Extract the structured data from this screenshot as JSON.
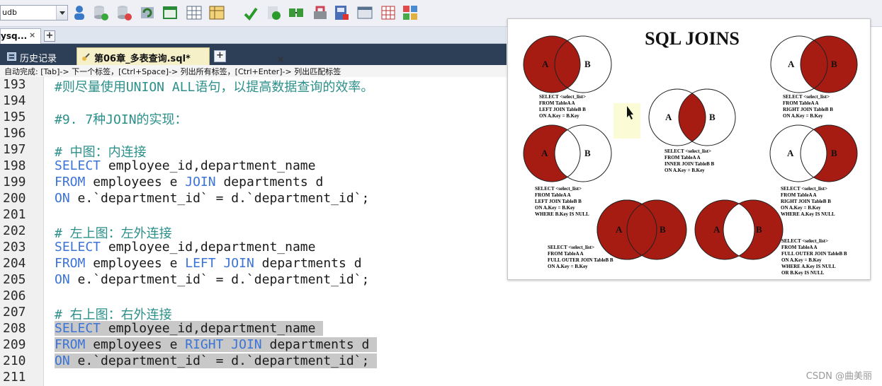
{
  "toolbar": {
    "db_select_value": "udb"
  },
  "tabs_top": {
    "connection_tab": "ysq...",
    "close_glyph": "×",
    "add_glyph": "+"
  },
  "editor_tabs": {
    "history": "历史记录",
    "sql_file": "第06章_多表查询.sql*",
    "close_glyph": "×",
    "add_glyph": "+"
  },
  "hint": "自动完成: [Tab]-> 下一个标签，[Ctrl+Space]-> 列出所有标签，[Ctrl+Enter]-> 列出匹配标签",
  "lines": [
    {
      "n": "193",
      "parts": [
        {
          "t": "#则尽量使用UNION ALL语句，以提高数据查询的效率。",
          "c": "cm"
        }
      ]
    },
    {
      "n": "194",
      "parts": []
    },
    {
      "n": "195",
      "parts": [
        {
          "t": "#9. 7种JOIN的实现：",
          "c": "cm"
        }
      ]
    },
    {
      "n": "196",
      "parts": []
    },
    {
      "n": "197",
      "parts": [
        {
          "t": "# 中图：内连接",
          "c": "cm"
        }
      ]
    },
    {
      "n": "198",
      "parts": [
        {
          "t": "SELECT",
          "c": "kw"
        },
        {
          "t": " employee_id,department_name",
          "c": ""
        }
      ]
    },
    {
      "n": "199",
      "parts": [
        {
          "t": "FROM",
          "c": "kw"
        },
        {
          "t": " employees e ",
          "c": ""
        },
        {
          "t": "JOIN",
          "c": "kw"
        },
        {
          "t": " departments d",
          "c": ""
        }
      ]
    },
    {
      "n": "200",
      "parts": [
        {
          "t": "ON",
          "c": "kw"
        },
        {
          "t": " e.`department_id` = d.`department_id`;",
          "c": ""
        }
      ]
    },
    {
      "n": "201",
      "parts": []
    },
    {
      "n": "202",
      "parts": [
        {
          "t": "# 左上图：左外连接",
          "c": "cm"
        }
      ]
    },
    {
      "n": "203",
      "parts": [
        {
          "t": "SELECT",
          "c": "kw"
        },
        {
          "t": " employee_id,department_name",
          "c": ""
        }
      ]
    },
    {
      "n": "204",
      "parts": [
        {
          "t": "FROM",
          "c": "kw"
        },
        {
          "t": " employees e ",
          "c": ""
        },
        {
          "t": "LEFT",
          "c": "kw"
        },
        {
          "t": " ",
          "c": ""
        },
        {
          "t": "JOIN",
          "c": "kw"
        },
        {
          "t": " departments d",
          "c": ""
        }
      ]
    },
    {
      "n": "205",
      "parts": [
        {
          "t": "ON",
          "c": "kw"
        },
        {
          "t": " e.`department_id` = d.`department_id`;",
          "c": ""
        }
      ]
    },
    {
      "n": "206",
      "parts": []
    },
    {
      "n": "207",
      "parts": [
        {
          "t": "# 右上图：右外连接",
          "c": "cm"
        }
      ]
    },
    {
      "n": "208",
      "parts": [
        {
          "t": "SELECT",
          "c": "kw"
        },
        {
          "t": " employee_id,department_name",
          "c": ""
        }
      ],
      "selected": true
    },
    {
      "n": "209",
      "parts": [
        {
          "t": "FROM",
          "c": "kw"
        },
        {
          "t": " employees e ",
          "c": ""
        },
        {
          "t": "RIGHT",
          "c": "kw"
        },
        {
          "t": " ",
          "c": ""
        },
        {
          "t": "JOIN",
          "c": "kw"
        },
        {
          "t": " departments d",
          "c": ""
        }
      ],
      "selected": true
    },
    {
      "n": "210",
      "parts": [
        {
          "t": "ON",
          "c": "kw"
        },
        {
          "t": " e.`department_id` = d.`department_id`;",
          "c": ""
        }
      ],
      "selected": true
    },
    {
      "n": "211",
      "parts": []
    }
  ],
  "joins": {
    "title": "SQL JOINS",
    "label_a": "A",
    "label_b": "B",
    "fill_color": "#a61b12",
    "captions": {
      "left_top": [
        "SELECT <select_list>",
        "FROM TableA A",
        "LEFT JOIN TableB B",
        "ON A.Key = B.Key"
      ],
      "right_top": [
        "SELECT <select_list>",
        "FROM TableA A",
        "RIGHT JOIN TableB B",
        "ON A.Key = B.Key"
      ],
      "inner": [
        "SELECT <select_list>",
        "FROM TableA A",
        "INNER JOIN TableB B",
        "ON A.Key = B.Key"
      ],
      "left_only": [
        "SELECT <select_list>",
        "FROM TableA A",
        "LEFT JOIN TableB B",
        "ON A.Key = B.Key",
        "WHERE B.Key IS NULL"
      ],
      "right_only": [
        "SELECT <select_list>",
        "FROM TableA A",
        "RIGHT JOIN TableB B",
        "ON A.Key = B.Key",
        "WHERE A.Key IS NULL"
      ],
      "full_outer": [
        "SELECT <select_list>",
        "FROM TableA A",
        "FULL OUTER JOIN TableB B",
        "ON A.Key = B.Key"
      ],
      "full_outer_excl": [
        "SELECT <select_list>",
        "FROM TableA A",
        "FULL OUTER JOIN TableB B",
        "ON A.Key = B.Key",
        "WHERE A.Key IS NULL",
        "OR B.Key IS NULL"
      ]
    }
  },
  "watermark": "CSDN @曲美丽"
}
